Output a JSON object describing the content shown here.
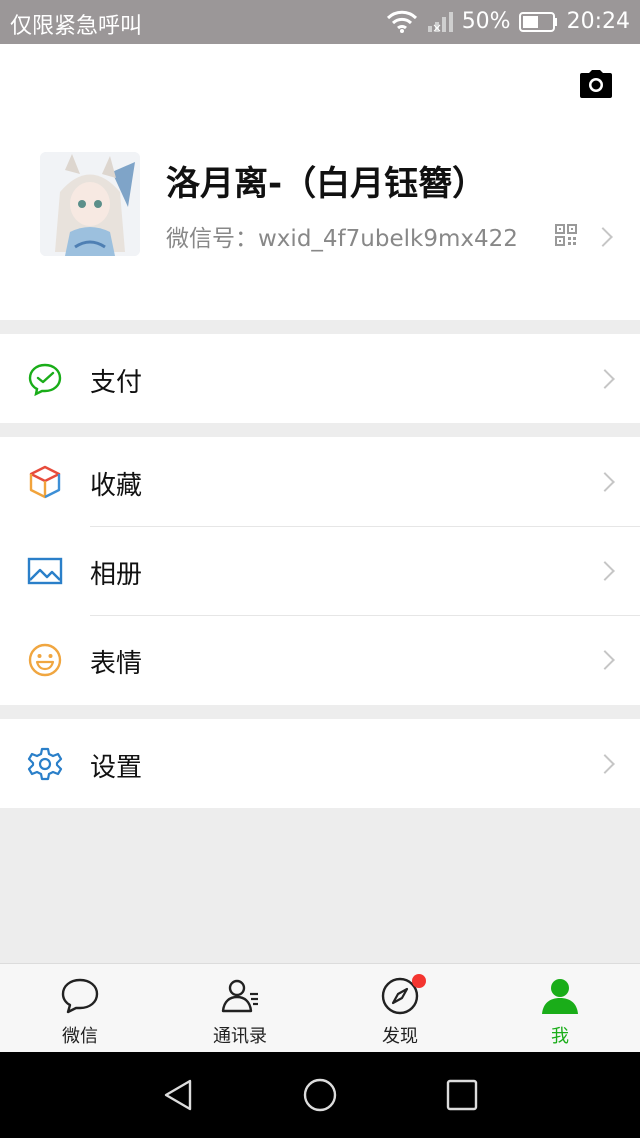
{
  "status": {
    "carrier": "仅限紧急呼叫",
    "battery": "50%",
    "time": "20:24"
  },
  "profile": {
    "name": "洛月离-（白月钰簪）",
    "wxid_label": "微信号：wxid_4f7ubelk9mx422"
  },
  "menu": {
    "pay": "支付",
    "favorites": "收藏",
    "album": "相册",
    "stickers": "表情",
    "settings": "设置"
  },
  "tabs": [
    {
      "label": "微信"
    },
    {
      "label": "通讯录"
    },
    {
      "label": "发现"
    },
    {
      "label": "我"
    }
  ],
  "colors": {
    "accent_green": "#1aad19",
    "badge_red": "#f43530"
  },
  "icons": {
    "camera": "camera-icon",
    "qrcode": "qrcode-icon",
    "pay": "pay-icon",
    "favorites": "cube-icon",
    "album": "image-icon",
    "stickers": "smiley-icon",
    "settings": "gear-icon"
  }
}
